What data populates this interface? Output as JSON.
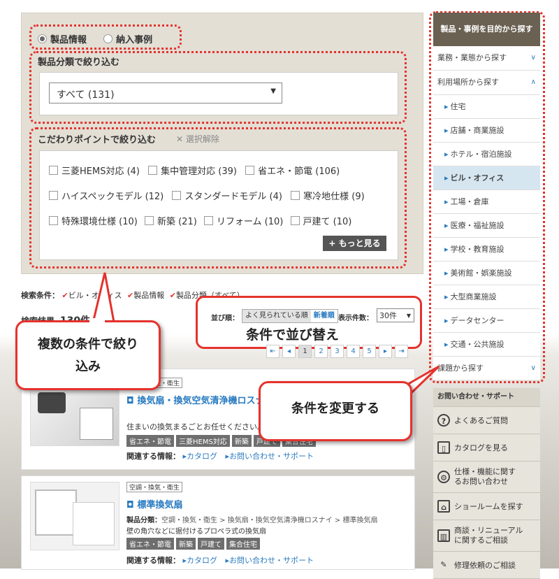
{
  "search_type": {
    "option1": "製品情報",
    "option2": "納入事例"
  },
  "category": {
    "title": "製品分類で絞り込む",
    "select_value": "すべて (131)"
  },
  "points": {
    "title": "こだわりポイントで絞り込む",
    "clear": "選択解除",
    "row1": [
      "三菱HEMS対応 (4)",
      "集中管理対応 (39)",
      "省エネ・節電 (106)"
    ],
    "row2": [
      "ハイスペックモデル (12)",
      "スタンダードモデル (4)",
      "寒冷地仕様 (9)"
    ],
    "row3": [
      "特殊環境仕様 (10)",
      "新築 (21)",
      "リフォーム (10)",
      "戸建て (10)"
    ],
    "more": "もっと見る"
  },
  "conditions": {
    "label": "検索条件：",
    "items": [
      "ビル・オフィス",
      "製品情報",
      "製品分類（すべて）"
    ]
  },
  "results": {
    "label": "検索結果",
    "count": "130件"
  },
  "sort": {
    "label": "並び順：",
    "opt1": "よく見られている順",
    "opt2": "新着順",
    "count_label": "表示件数：",
    "count_value": "30件"
  },
  "pagination": [
    "1",
    "2",
    "3",
    "4",
    "5"
  ],
  "annotations": {
    "a1": "条件で並び替え",
    "a2": "複数の条件で絞り込み",
    "a3": "条件を変更する"
  },
  "right_nav": {
    "header": "製品・事例を目的から探す",
    "business": "業務・業態から探す",
    "location": "利用場所から探す",
    "items": [
      "住宅",
      "店舗・商業施設",
      "ホテル・宿泊施設",
      "ビル・オフィス",
      "工場・倉庫",
      "医療・福祉施設",
      "学校・教育施設",
      "美術館・娯楽施設",
      "大型商業施設",
      "データセンター",
      "交通・公共施設"
    ],
    "issues": "課題から探す"
  },
  "support": {
    "header": "お問い合わせ・サポート",
    "items": [
      "よくあるご質問",
      "カタログを見る",
      "仕様・機能に関するお問い合わせ",
      "ショールームを探す",
      "商談・リニューアルに関するご相談",
      "修理依頼のご相談"
    ]
  },
  "product1": {
    "category_tag": "空調・換気・衛生",
    "title": "換気扇・換気空気清浄機ロスナイ",
    "desc": "住まいの換気まるごとお任せください。",
    "tags": [
      "省エネ・節電",
      "三菱HEMS対応",
      "新築",
      "戸建て",
      "集合住宅"
    ],
    "related_label": "関連する情報：",
    "link1": "カタログ",
    "link2": "お問い合わせ・サポート"
  },
  "product2": {
    "category_tag": "空調・換気・衛生",
    "title": "標準換気扇",
    "category_label": "製品分類：",
    "category": "空調・換気・衛生 > 換気扇・換気空気清浄機ロスナイ > 標準換気扇",
    "desc": "壁の角穴などに据付けるプロペラ式の換気扇",
    "tags": [
      "省エネ・節電",
      "新築",
      "戸建て",
      "集合住宅"
    ],
    "related_label": "関連する情報：",
    "link1": "カタログ",
    "link2": "お問い合わせ・サポート"
  }
}
